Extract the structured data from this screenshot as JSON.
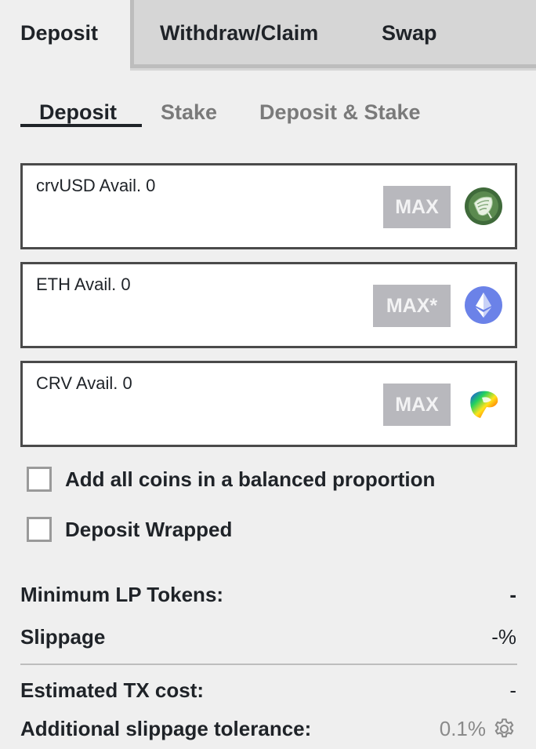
{
  "top_tabs": {
    "deposit": "Deposit",
    "withdraw": "Withdraw/Claim",
    "swap": "Swap"
  },
  "sub_tabs": {
    "deposit": "Deposit",
    "stake": "Stake",
    "deposit_stake": "Deposit & Stake"
  },
  "coins": [
    {
      "label": "crvUSD Avail. 0",
      "max_label": "MAX",
      "icon": "crvusd-icon",
      "value": ""
    },
    {
      "label": "ETH Avail. 0",
      "max_label": "MAX*",
      "icon": "eth-icon",
      "value": ""
    },
    {
      "label": "CRV Avail. 0",
      "max_label": "MAX",
      "icon": "crv-icon",
      "value": ""
    }
  ],
  "options": {
    "balanced": "Add all coins in a balanced proportion",
    "wrapped": "Deposit Wrapped"
  },
  "details": {
    "min_lp_label": "Minimum LP Tokens:",
    "min_lp_value": "-",
    "slippage_label": "Slippage",
    "slippage_value": "-%",
    "tx_cost_label": "Estimated TX cost:",
    "tx_cost_value": "-",
    "tolerance_label": "Additional slippage tolerance:",
    "tolerance_value": "0.1%"
  },
  "colors": {
    "background": "#efefef",
    "tab_inactive": "#d6d6d6",
    "text": "#1f2328",
    "max_button": "#b8b8bd",
    "crvusd_green": "#3f6a3a",
    "eth_blue": "#6b82e8"
  }
}
